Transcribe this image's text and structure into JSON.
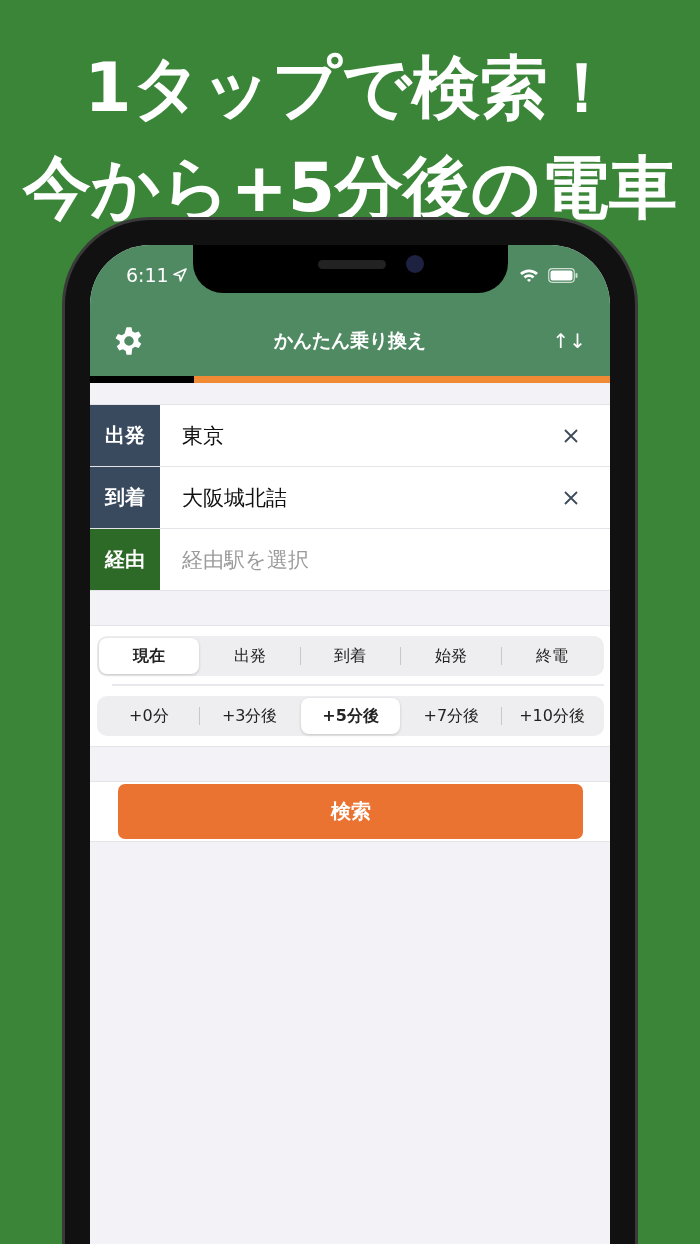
{
  "headline": [
    "1タップで検索！",
    "今から+5分後の電車"
  ],
  "status_bar": {
    "time": "6:11"
  },
  "nav": {
    "title": "かんたん乗り換え",
    "swap": "↑↓"
  },
  "progress": {
    "level": 0.2
  },
  "stations": [
    {
      "label": "出発",
      "color": "#394a5f",
      "value": "東京"
    },
    {
      "label": "到着",
      "color": "#394a5f",
      "value": "大阪城北詰"
    },
    {
      "label": "経由",
      "color": "#2d6a27",
      "placeholder": "経由駅を選択"
    }
  ],
  "mode_segments": [
    {
      "label": "現在",
      "selected": true
    },
    {
      "label": "出発",
      "selected": false
    },
    {
      "label": "到着",
      "selected": false
    },
    {
      "label": "始発",
      "selected": false
    },
    {
      "label": "終電",
      "selected": false
    }
  ],
  "offset_segments": [
    {
      "label": "+0分",
      "selected": false
    },
    {
      "label": "+3分後",
      "selected": false
    },
    {
      "label": "+5分後",
      "selected": true
    },
    {
      "label": "+7分後",
      "selected": false
    },
    {
      "label": "+10分後",
      "selected": false
    }
  ],
  "search_button": "検索"
}
